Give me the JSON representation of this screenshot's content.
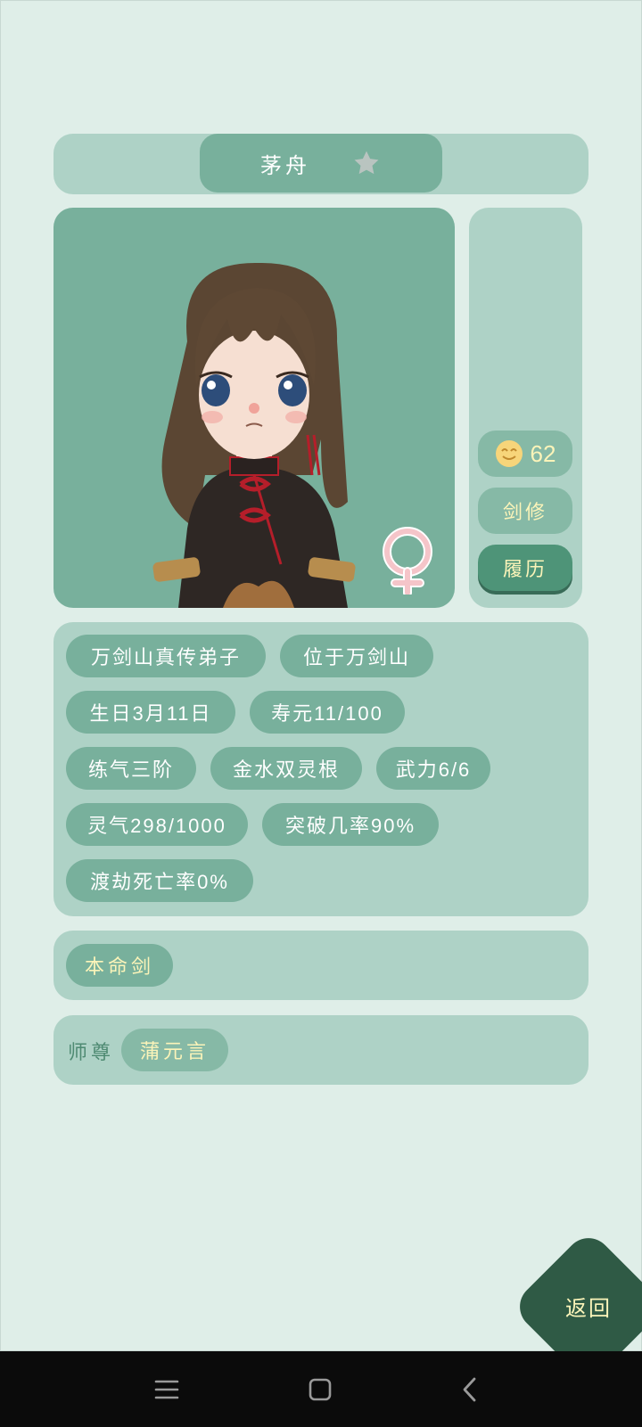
{
  "character": {
    "name": "茅舟",
    "favorite_icon": "star-icon"
  },
  "stats": {
    "mood_icon": "smiling-face-icon",
    "mood_value": "62",
    "sect_label": "剑修",
    "history_label": "履历",
    "gender_icon": "female-symbol-icon"
  },
  "tags": [
    "万剑山真传弟子",
    "位于万剑山",
    "生日3月11日",
    "寿元11/100",
    "练气三阶",
    "金水双灵根",
    "武力6/6",
    "灵气298/1000",
    "突破几率90%",
    "渡劫死亡率0%"
  ],
  "sword": {
    "label": "本命剑"
  },
  "master": {
    "label": "师尊",
    "name": "蒲元言"
  },
  "back_button": {
    "label": "返回"
  },
  "navbar": {
    "icons": [
      "menu-icon",
      "home-square-icon",
      "back-chevron-icon"
    ]
  },
  "colors": {
    "background": "#dfeee8",
    "panel": "#aed2c6",
    "chip": "#78b09c",
    "accent_text": "#fbf4b9",
    "back_button": "#2f5a45"
  }
}
